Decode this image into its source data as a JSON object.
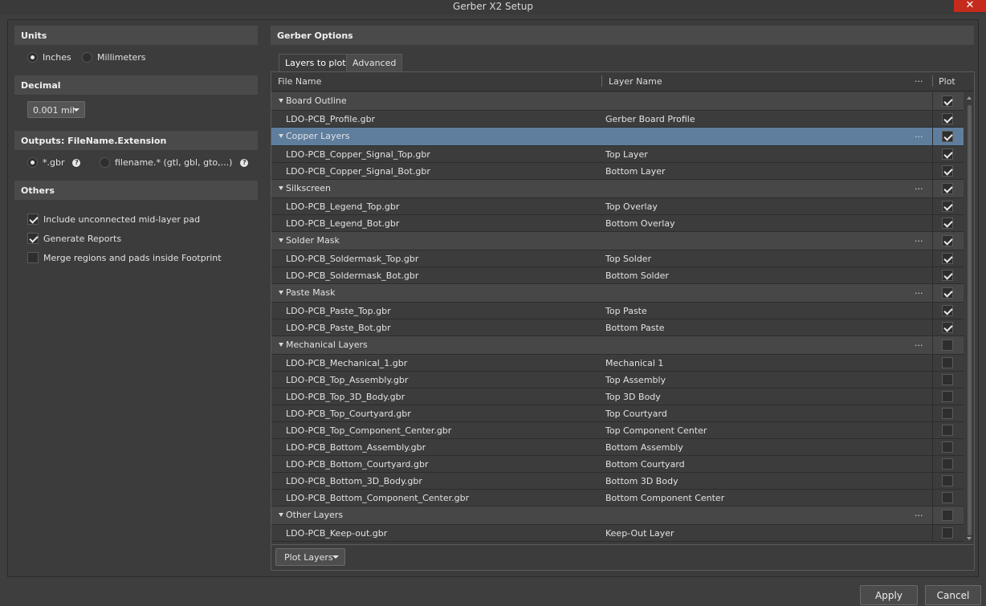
{
  "window": {
    "title": "Gerber X2 Setup",
    "close_glyph": "✕"
  },
  "units": {
    "heading": "Units",
    "options": [
      {
        "label": "Inches",
        "selected": true
      },
      {
        "label": "Millimeters",
        "selected": false
      }
    ]
  },
  "decimal": {
    "heading": "Decimal",
    "value": "0.001 mil"
  },
  "outputs": {
    "heading": "Outputs: FileName.Extension",
    "options": [
      {
        "label": "*.gbr",
        "selected": true
      },
      {
        "label": "filename.* (gtl, gbl, gto,...)",
        "selected": false
      }
    ],
    "help_glyph": "?"
  },
  "others": {
    "heading": "Others",
    "checks": [
      {
        "label": "Include unconnected mid-layer pad",
        "checked": true
      },
      {
        "label": "Generate Reports",
        "checked": true
      },
      {
        "label": "Merge regions and pads inside Footprint",
        "checked": false
      }
    ]
  },
  "gerber": {
    "heading": "Gerber Options",
    "tabs": [
      {
        "label": "Layers to plot",
        "active": true
      },
      {
        "label": "Advanced",
        "active": false
      }
    ],
    "columns": {
      "file": "File Name",
      "layer": "Layer Name",
      "more": "...",
      "plot": "Plot"
    },
    "groups": [
      {
        "name": "Board Outline",
        "checked": true,
        "selected": false,
        "has_more": false,
        "rows": [
          {
            "file": "LDO-PCB_Profile.gbr",
            "layer": "Gerber Board Profile",
            "checked": true
          }
        ]
      },
      {
        "name": "Copper Layers",
        "checked": true,
        "selected": true,
        "has_more": true,
        "rows": [
          {
            "file": "LDO-PCB_Copper_Signal_Top.gbr",
            "layer": "Top Layer",
            "checked": true
          },
          {
            "file": "LDO-PCB_Copper_Signal_Bot.gbr",
            "layer": "Bottom Layer",
            "checked": true
          }
        ]
      },
      {
        "name": "Silkscreen",
        "checked": true,
        "selected": false,
        "has_more": true,
        "rows": [
          {
            "file": "LDO-PCB_Legend_Top.gbr",
            "layer": "Top Overlay",
            "checked": true
          },
          {
            "file": "LDO-PCB_Legend_Bot.gbr",
            "layer": "Bottom Overlay",
            "checked": true
          }
        ]
      },
      {
        "name": "Solder Mask",
        "checked": true,
        "selected": false,
        "has_more": true,
        "rows": [
          {
            "file": "LDO-PCB_Soldermask_Top.gbr",
            "layer": "Top Solder",
            "checked": true
          },
          {
            "file": "LDO-PCB_Soldermask_Bot.gbr",
            "layer": "Bottom Solder",
            "checked": true
          }
        ]
      },
      {
        "name": "Paste Mask",
        "checked": true,
        "selected": false,
        "has_more": true,
        "rows": [
          {
            "file": "LDO-PCB_Paste_Top.gbr",
            "layer": "Top Paste",
            "checked": true
          },
          {
            "file": "LDO-PCB_Paste_Bot.gbr",
            "layer": "Bottom Paste",
            "checked": true
          }
        ]
      },
      {
        "name": "Mechanical Layers",
        "checked": false,
        "selected": false,
        "has_more": true,
        "rows": [
          {
            "file": "LDO-PCB_Mechanical_1.gbr",
            "layer": "Mechanical 1",
            "checked": false
          },
          {
            "file": "LDO-PCB_Top_Assembly.gbr",
            "layer": "Top Assembly",
            "checked": false
          },
          {
            "file": "LDO-PCB_Top_3D_Body.gbr",
            "layer": "Top 3D Body",
            "checked": false
          },
          {
            "file": "LDO-PCB_Top_Courtyard.gbr",
            "layer": "Top Courtyard",
            "checked": false
          },
          {
            "file": "LDO-PCB_Top_Component_Center.gbr",
            "layer": "Top Component Center",
            "checked": false
          },
          {
            "file": "LDO-PCB_Bottom_Assembly.gbr",
            "layer": "Bottom Assembly",
            "checked": false
          },
          {
            "file": "LDO-PCB_Bottom_Courtyard.gbr",
            "layer": "Bottom Courtyard",
            "checked": false
          },
          {
            "file": "LDO-PCB_Bottom_3D_Body.gbr",
            "layer": "Bottom 3D Body",
            "checked": false
          },
          {
            "file": "LDO-PCB_Bottom_Component_Center.gbr",
            "layer": "Bottom Component Center",
            "checked": false
          }
        ]
      },
      {
        "name": "Other Layers",
        "checked": false,
        "selected": false,
        "has_more": true,
        "rows": [
          {
            "file": "LDO-PCB_Keep-out.gbr",
            "layer": "Keep-Out Layer",
            "checked": false
          }
        ]
      }
    ],
    "plot_layers_button": "Plot Layers"
  },
  "footer": {
    "apply": "Apply",
    "cancel": "Cancel"
  },
  "colors": {
    "selection": "#5f7e9e",
    "close": "#c42b1c"
  }
}
